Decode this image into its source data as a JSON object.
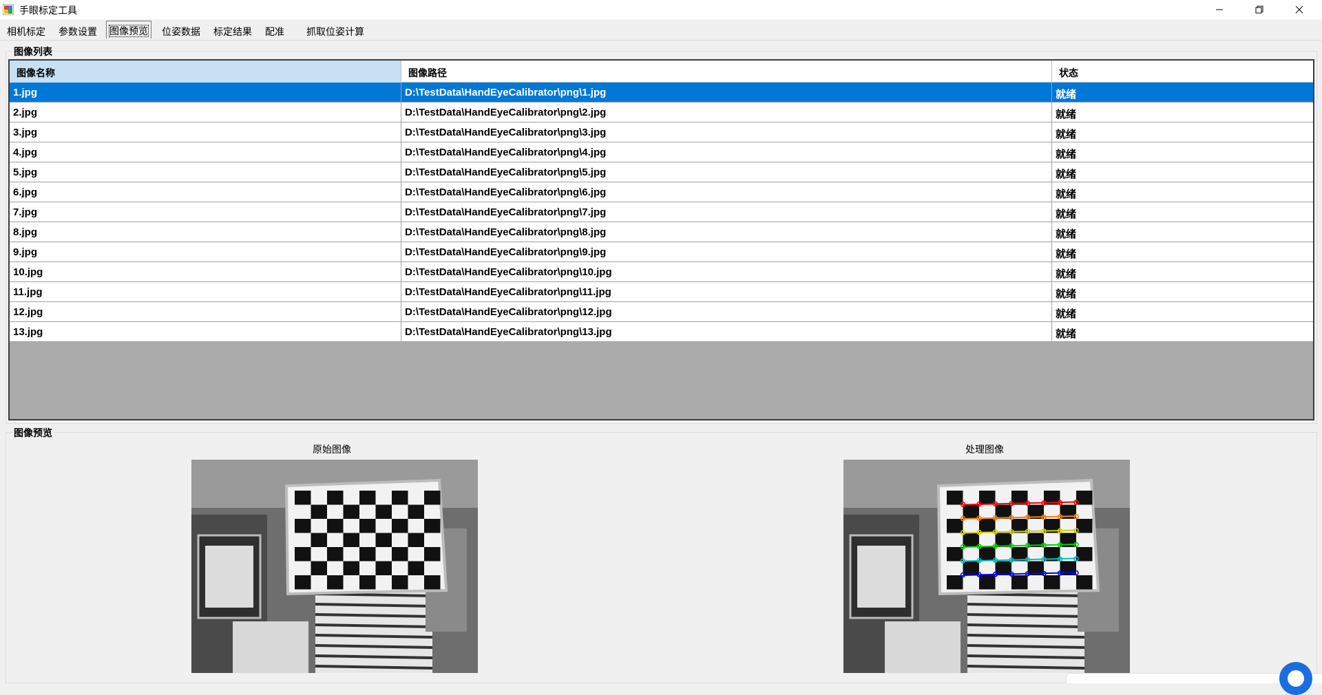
{
  "window": {
    "title": "手眼标定工具",
    "controls": {
      "minimize": "minimize-icon",
      "maximize": "restore-icon",
      "close": "close-icon"
    }
  },
  "tabs": [
    {
      "label": "相机标定",
      "active": false
    },
    {
      "label": "参数设置",
      "active": false
    },
    {
      "label": "图像预览",
      "active": true
    },
    {
      "label": "位姿数据",
      "active": false
    },
    {
      "label": "标定结果",
      "active": false
    },
    {
      "label": "配准",
      "active": false
    },
    {
      "label": "抓取位姿计算",
      "active": false
    }
  ],
  "image_list": {
    "title": "图像列表",
    "columns": [
      "图像名称",
      "图像路径",
      "状态"
    ],
    "rows": [
      {
        "name": "1.jpg",
        "path": "D:\\TestData\\HandEyeCalibrator\\png\\1.jpg",
        "status": "就绪"
      },
      {
        "name": "2.jpg",
        "path": "D:\\TestData\\HandEyeCalibrator\\png\\2.jpg",
        "status": "就绪"
      },
      {
        "name": "3.jpg",
        "path": "D:\\TestData\\HandEyeCalibrator\\png\\3.jpg",
        "status": "就绪"
      },
      {
        "name": "4.jpg",
        "path": "D:\\TestData\\HandEyeCalibrator\\png\\4.jpg",
        "status": "就绪"
      },
      {
        "name": "5.jpg",
        "path": "D:\\TestData\\HandEyeCalibrator\\png\\5.jpg",
        "status": "就绪"
      },
      {
        "name": "6.jpg",
        "path": "D:\\TestData\\HandEyeCalibrator\\png\\6.jpg",
        "status": "就绪"
      },
      {
        "name": "7.jpg",
        "path": "D:\\TestData\\HandEyeCalibrator\\png\\7.jpg",
        "status": "就绪"
      },
      {
        "name": "8.jpg",
        "path": "D:\\TestData\\HandEyeCalibrator\\png\\8.jpg",
        "status": "就绪"
      },
      {
        "name": "9.jpg",
        "path": "D:\\TestData\\HandEyeCalibrator\\png\\9.jpg",
        "status": "就绪"
      },
      {
        "name": "10.jpg",
        "path": "D:\\TestData\\HandEyeCalibrator\\png\\10.jpg",
        "status": "就绪"
      },
      {
        "name": "11.jpg",
        "path": "D:\\TestData\\HandEyeCalibrator\\png\\11.jpg",
        "status": "就绪"
      },
      {
        "name": "12.jpg",
        "path": "D:\\TestData\\HandEyeCalibrator\\png\\12.jpg",
        "status": "就绪"
      },
      {
        "name": "13.jpg",
        "path": "D:\\TestData\\HandEyeCalibrator\\png\\13.jpg",
        "status": "就绪"
      }
    ],
    "selected_index": 0
  },
  "image_preview": {
    "title": "图像预览",
    "original_label": "原始图像",
    "processed_label": "处理图像"
  },
  "colors": {
    "selection": "#0078d7",
    "header_selected": "#c7e0f4",
    "grid_background": "#ababab",
    "corner_lines": [
      "#ff0000",
      "#ff8000",
      "#d0d000",
      "#00d000",
      "#00c0c0",
      "#0000ff"
    ]
  }
}
